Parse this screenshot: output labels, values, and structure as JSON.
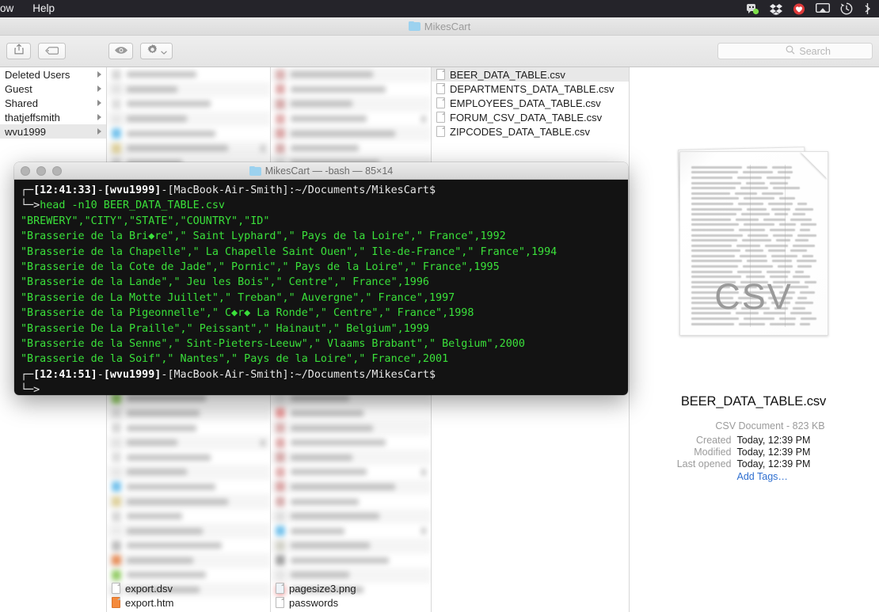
{
  "menubar": {
    "items": [
      {
        "label": "ow",
        "name": "menu-window"
      },
      {
        "label": "Help",
        "name": "menu-help"
      }
    ],
    "status_icons": [
      {
        "name": "chat-icon"
      },
      {
        "name": "dropbox-icon"
      },
      {
        "name": "heart-shield-icon"
      },
      {
        "name": "airplay-icon"
      },
      {
        "name": "time-machine-icon"
      },
      {
        "name": "bluetooth-icon"
      }
    ]
  },
  "finder": {
    "title": "MikesCart",
    "toolbar": {
      "share_icon": "share-icon",
      "tag_icon": "tag-icon",
      "quicklook_icon": "eye-icon",
      "action_icon": "gear-icon",
      "search_placeholder": "Search"
    },
    "column1": {
      "items": [
        {
          "label": "Deleted Users",
          "has_arrow": true,
          "selected": false
        },
        {
          "label": "Guest",
          "has_arrow": true,
          "selected": false
        },
        {
          "label": "Shared",
          "has_arrow": true,
          "selected": false
        },
        {
          "label": "thatjeffsmith",
          "has_arrow": true,
          "selected": false
        },
        {
          "label": "wvu1999",
          "has_arrow": true,
          "selected": true
        }
      ]
    },
    "column4": {
      "items": [
        {
          "label": "BEER_DATA_TABLE.csv",
          "selected": true
        },
        {
          "label": "DEPARTMENTS_DATA_TABLE.csv",
          "selected": false
        },
        {
          "label": "EMPLOYEES_DATA_TABLE.csv",
          "selected": false
        },
        {
          "label": "FORUM_CSV_DATA_TABLE.csv",
          "selected": false
        },
        {
          "label": "ZIPCODES_DATA_TABLE.csv",
          "selected": false
        }
      ]
    },
    "column2_visible_items": [
      {
        "label": "export.dsv"
      },
      {
        "label": "export.htm"
      }
    ],
    "column3_visible_items": [
      {
        "label": "pagesize3.png"
      },
      {
        "label": "passwords"
      }
    ],
    "preview": {
      "thumbnail_watermark": "CSV",
      "filename": "BEER_DATA_TABLE.csv",
      "kind_and_size": "CSV Document - 823 KB",
      "created_label": "Created",
      "created_value": "Today, 12:39 PM",
      "modified_label": "Modified",
      "modified_value": "Today, 12:39 PM",
      "last_opened_label": "Last opened",
      "last_opened_value": "Today, 12:39 PM",
      "add_tags": "Add Tags…"
    }
  },
  "terminal": {
    "title": "MikesCart — -bash — 85×14",
    "lines": [
      {
        "type": "prompt",
        "time": "[12:41:33]",
        "user": "[wvu1999]",
        "host": "[MacBook-Air-Smith]",
        "path": ":~/Documents/MikesCart$"
      },
      {
        "type": "command",
        "text": "head -n10 BEER_DATA_TABLE.csv"
      },
      {
        "type": "output",
        "text": "\"BREWERY\",\"CITY\",\"STATE\",\"COUNTRY\",\"ID\""
      },
      {
        "type": "output",
        "text": "\"Brasserie de la Bri◆re\",\" Saint Lyphard\",\" Pays de la Loire\",\" France\",1992"
      },
      {
        "type": "output",
        "text": "\"Brasserie de la Chapelle\",\" La Chapelle Saint Ouen\",\" Ile-de-France\",\" France\",1994"
      },
      {
        "type": "output",
        "text": "\"Brasserie de la Cote de Jade\",\" Pornic\",\" Pays de la Loire\",\" France\",1995"
      },
      {
        "type": "output",
        "text": "\"Brasserie de la Lande\",\" Jeu les Bois\",\" Centre\",\" France\",1996"
      },
      {
        "type": "output",
        "text": "\"Brasserie de La Motte Juillet\",\" Treban\",\" Auvergne\",\" France\",1997"
      },
      {
        "type": "output",
        "text": "\"Brasserie de la Pigeonnelle\",\" C◆r◆ La Ronde\",\" Centre\",\" France\",1998"
      },
      {
        "type": "output",
        "text": "\"Brasserie De La Praille\",\" Peissant\",\" Hainaut\",\" Belgium\",1999"
      },
      {
        "type": "output",
        "text": "\"Brasserie de la Senne\",\" Sint-Pieters-Leeuw\",\" Vlaams Brabant\",\" Belgium\",2000"
      },
      {
        "type": "output",
        "text": "\"Brasserie de la Soif\",\" Nantes\",\" Pays de la Loire\",\" France\",2001"
      },
      {
        "type": "prompt",
        "time": "[12:41:51]",
        "user": "[wvu1999]",
        "host": "[MacBook-Air-Smith]",
        "path": ":~/Documents/MikesCart$"
      },
      {
        "type": "empty_prompt",
        "text": "└─>"
      }
    ],
    "prompt_prefix_top": "┌─",
    "prompt_prefix_bottom": "└─>",
    "dash": "—"
  },
  "colors": {
    "terminal_bg": "#131313",
    "terminal_green": "#35dd35",
    "terminal_white": "#e6e6e6",
    "menubar_bg": "#25242a",
    "link_blue": "#2f6fd0",
    "selection_grey": "#e8e8e8"
  }
}
